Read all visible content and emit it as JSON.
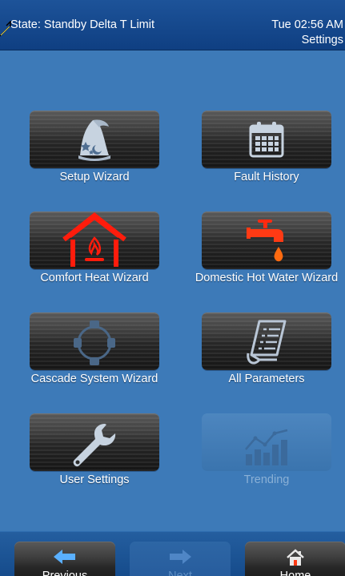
{
  "header": {
    "state": "State: Standby Delta T Limit",
    "clock": "Tue 02:56 AM",
    "breadcrumb": "Settings"
  },
  "tiles": [
    {
      "label": "Setup Wizard",
      "icon": "wizard-hat-icon",
      "enabled": true
    },
    {
      "label": "Fault History",
      "icon": "calendar-icon",
      "enabled": true
    },
    {
      "label": "Comfort Heat Wizard",
      "icon": "house-flame-icon",
      "enabled": true
    },
    {
      "label": "Domestic Hot Water Wizard",
      "icon": "faucet-drop-icon",
      "enabled": true
    },
    {
      "label": "Cascade System Wizard",
      "icon": "cascade-network-icon",
      "enabled": true
    },
    {
      "label": "All Parameters",
      "icon": "document-list-icon",
      "enabled": true
    },
    {
      "label": "User Settings",
      "icon": "wrench-icon",
      "enabled": true
    },
    {
      "label": "Trending",
      "icon": "trend-chart-icon",
      "enabled": false
    }
  ],
  "footer": {
    "previous": "Previous",
    "next": "Next",
    "home": "Home"
  },
  "colors": {
    "background": "#3d7ab8",
    "header": "#16498d",
    "accent_red": "#ff2a10",
    "arrow_blue": "#5ab0ff"
  }
}
